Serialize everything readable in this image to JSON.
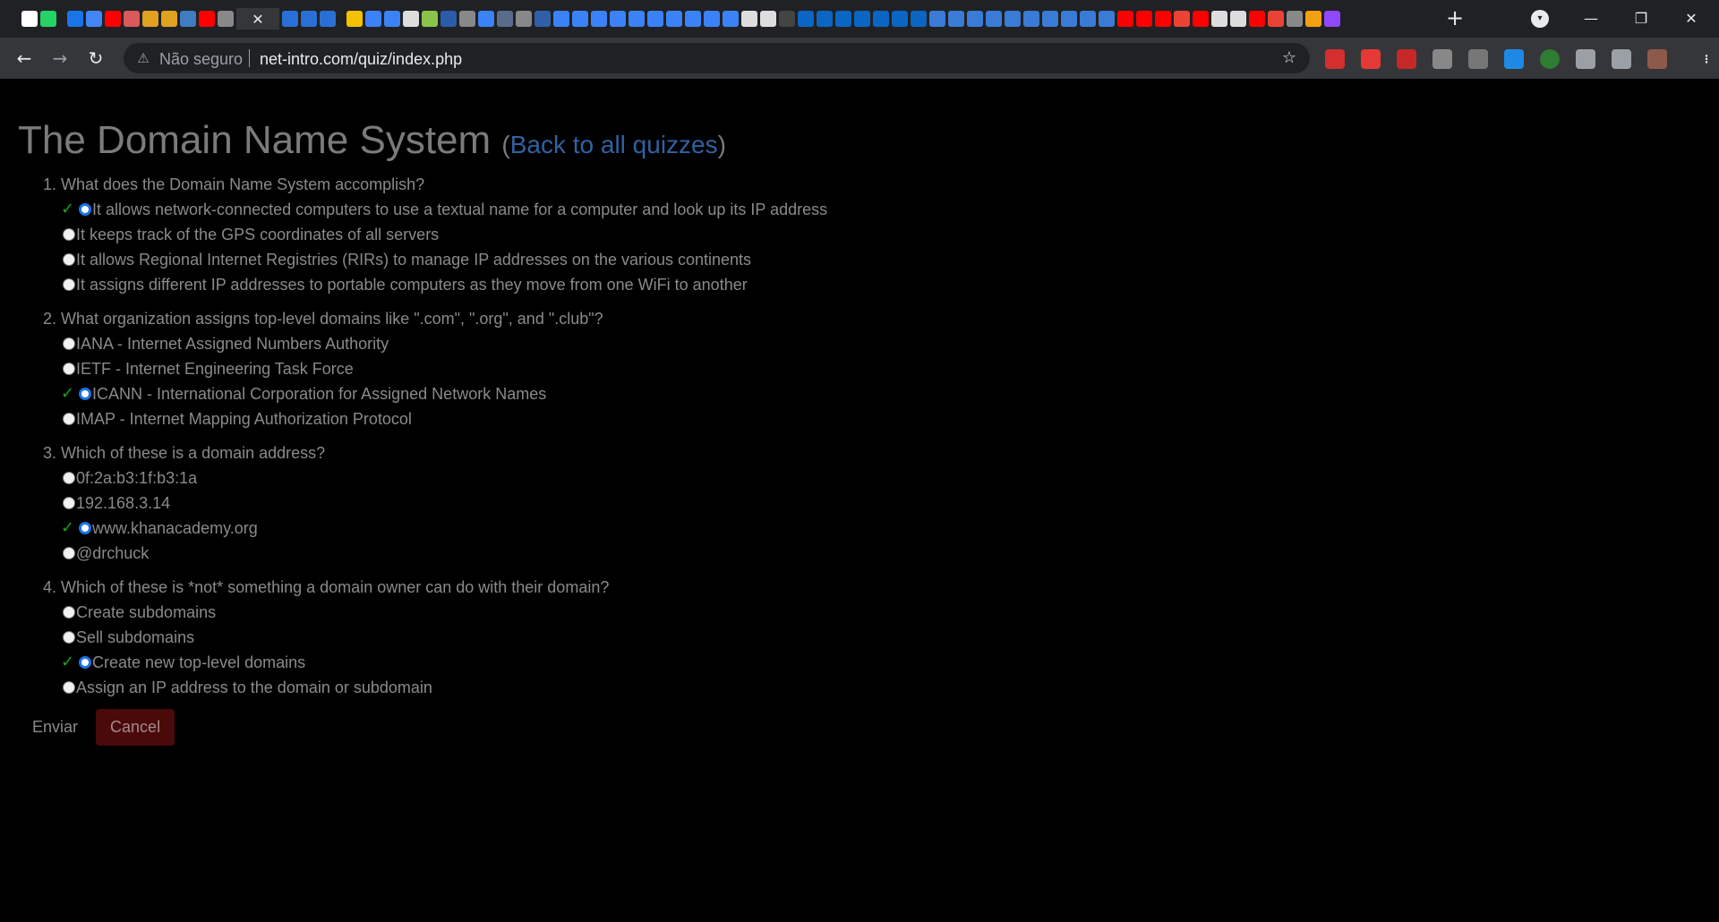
{
  "browser": {
    "active_tab_close": "✕",
    "new_tab": "+",
    "address": {
      "security_label": "Não seguro",
      "url": "net-intro.com/quiz/index.php"
    },
    "favicons": [
      "notion-icon",
      "whatsapp-icon",
      "gap",
      "messenger-icon",
      "google-docs-icon",
      "youtube-icon",
      "tool-icon",
      "jsf-icon",
      "jsf-icon",
      "python-icon",
      "youtube-icon",
      "chrome-icon",
      "active-tab",
      "c-icon",
      "c-icon",
      "c-icon",
      "gap",
      "khan-icon",
      "doc-icon",
      "doc-icon",
      "github-icon",
      "smiley-icon",
      "ieee-icon",
      "chrome-icon",
      "doc-icon",
      "shield-icon",
      "chrome-icon",
      "p-icon",
      "doc-icon",
      "doc-icon",
      "doc-icon",
      "doc-icon",
      "doc-icon",
      "doc-icon",
      "doc-icon",
      "doc-icon",
      "doc-icon",
      "doc-icon",
      "github-icon",
      "github-icon",
      "image-icon",
      "linkedin-icon",
      "linkedin-icon",
      "linkedin-icon",
      "linkedin-icon",
      "linkedin-icon",
      "linkedin-icon",
      "linkedin-icon",
      "swirl-icon",
      "swirl-icon",
      "swirl-icon",
      "swirl-icon",
      "swirl-icon",
      "swirl-icon",
      "swirl-icon",
      "swirl-icon",
      "swirl-icon",
      "swirl-icon",
      "youtube-icon",
      "youtube-icon",
      "youtube-icon",
      "google-icon",
      "youtube-icon",
      "github-icon",
      "github-icon",
      "youtube-icon",
      "google-icon",
      "chrome-icon",
      "windows-icon",
      "twitch-icon"
    ],
    "extensions": [
      "adblock-icon",
      "ext-red-icon",
      "ext-redpen-icon",
      "ext-glasses-icon",
      "ext-reader-icon",
      "ext-wave-icon",
      "ext-plus-icon",
      "puzzle-icon",
      "playlist-icon",
      "avatar-icon",
      "menu-icon"
    ]
  },
  "page": {
    "title": "The Domain Name System",
    "back_open": "(",
    "back_link": "Back to all quizzes",
    "back_close": ")",
    "check_mark": "✓",
    "questions": [
      {
        "text": "1. What does the Domain Name System accomplish?",
        "options": [
          {
            "text": "It allows network-connected computers to use a textual name for a computer and look up its IP address",
            "correct": true
          },
          {
            "text": "It keeps track of the GPS coordinates of all servers",
            "correct": false
          },
          {
            "text": "It allows Regional Internet Registries (RIRs) to manage IP addresses on the various continents",
            "correct": false
          },
          {
            "text": "It assigns different IP addresses to portable computers as they move from one WiFi to another",
            "correct": false
          }
        ]
      },
      {
        "text": "2. What organization assigns top-level domains like \".com\", \".org\", and \".club\"?",
        "options": [
          {
            "text": "IANA - Internet Assigned Numbers Authority",
            "correct": false
          },
          {
            "text": "IETF - Internet Engineering Task Force",
            "correct": false
          },
          {
            "text": "ICANN - International Corporation for Assigned Network Names",
            "correct": true
          },
          {
            "text": "IMAP - Internet Mapping Authorization Protocol",
            "correct": false
          }
        ]
      },
      {
        "text": "3. Which of these is a domain address?",
        "options": [
          {
            "text": "0f:2a:b3:1f:b3:1a",
            "correct": false
          },
          {
            "text": "192.168.3.14",
            "correct": false
          },
          {
            "text": "www.khanacademy.org",
            "correct": true
          },
          {
            "text": "@drchuck",
            "correct": false
          }
        ]
      },
      {
        "text": "4. Which of these is *not* something a domain owner can do with their domain?",
        "options": [
          {
            "text": "Create subdomains",
            "correct": false
          },
          {
            "text": "Sell subdomains",
            "correct": false
          },
          {
            "text": "Create new top-level domains",
            "correct": true
          },
          {
            "text": "Assign an IP address to the domain or subdomain",
            "correct": false
          }
        ]
      }
    ],
    "submit_label": "Enviar",
    "cancel_label": "Cancel"
  }
}
